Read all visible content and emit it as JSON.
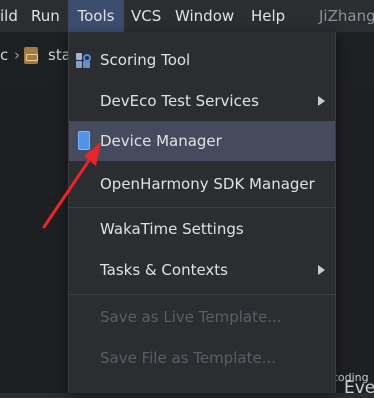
{
  "menubar": {
    "items": [
      "ild",
      "Run",
      "Tools",
      "VCS",
      "Window",
      "Help"
    ],
    "project_title": "JiZhang"
  },
  "breadcrumb": {
    "left": "c",
    "file": "sta"
  },
  "tools_menu": {
    "items": [
      {
        "label": "Scoring Tool"
      },
      {
        "label": "DevEco Test Services"
      },
      {
        "label": "Device Manager"
      },
      {
        "label": "OpenHarmony SDK Manager"
      },
      {
        "label": "WakaTime Settings"
      },
      {
        "label": "Tasks & Contexts"
      },
      {
        "label": "Save as Live Template..."
      },
      {
        "label": "Save File as Template..."
      }
    ]
  },
  "background": {
    "watermark": "CSDN @弈鸣coding",
    "corner_text": "Eve"
  }
}
